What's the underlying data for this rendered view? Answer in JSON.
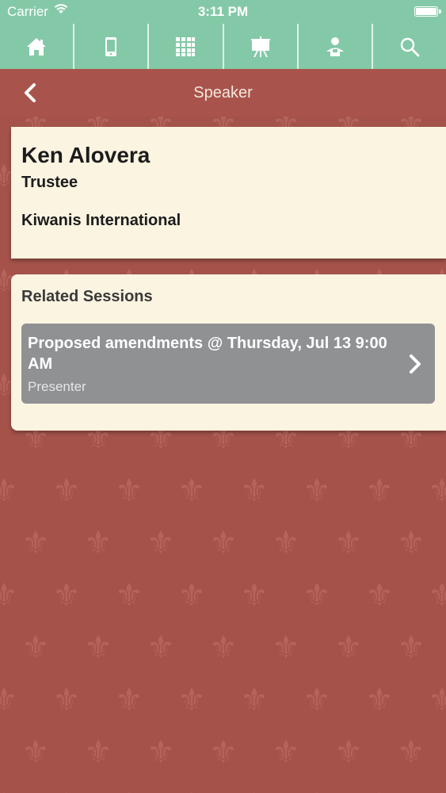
{
  "status_bar": {
    "carrier": "Carrier",
    "time": "3:11 PM"
  },
  "nav_icons": [
    "home-icon",
    "mobile-device-icon",
    "grid-icon",
    "easel-icon",
    "speaker-person-icon",
    "search-icon"
  ],
  "header": {
    "title": "Speaker"
  },
  "speaker": {
    "name": "Ken Alovera",
    "title": "Trustee",
    "organization": "Kiwanis International"
  },
  "related": {
    "heading": "Related Sessions",
    "sessions": [
      {
        "title": "Proposed amendments @ Thursday, Jul 13 9:00 AM",
        "role": "Presenter"
      }
    ]
  },
  "colors": {
    "topbar": "#84c9a7",
    "titlebar": "#a8544c",
    "background": "#a4524a",
    "card": "#faf4e1",
    "session_row": "#8f9193"
  }
}
